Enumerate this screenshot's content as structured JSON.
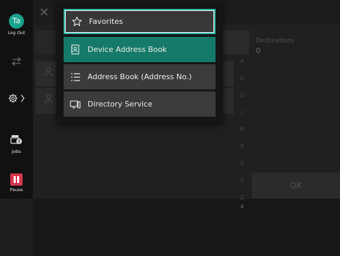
{
  "rail": {
    "user_initials": "Ta",
    "logout_label": "Log Out",
    "interrupt_label": "Interrupt",
    "jobs_label": "Jobs",
    "pause_label": "Pause"
  },
  "background": {
    "destinations_label": "Destinations",
    "destinations_count": "0",
    "ok_label": "OK",
    "index_letters": [
      "A",
      "D",
      "G",
      "J",
      "M",
      "P",
      "S",
      "V",
      "Z",
      "#"
    ]
  },
  "menu": {
    "items": [
      {
        "label": "Favorites",
        "icon": "star-outline-icon",
        "state": "focused"
      },
      {
        "label": "Device Address Book",
        "icon": "address-book-icon",
        "state": "selected"
      },
      {
        "label": "Address Book (Address No.)",
        "icon": "numbered-list-icon",
        "state": "normal"
      },
      {
        "label": "Directory Service",
        "icon": "directory-server-icon",
        "state": "normal"
      }
    ]
  },
  "colors": {
    "accent": "#2fbba5",
    "selected": "#167a6a",
    "avatar": "#1aa38d",
    "pause": "#d8354e"
  }
}
